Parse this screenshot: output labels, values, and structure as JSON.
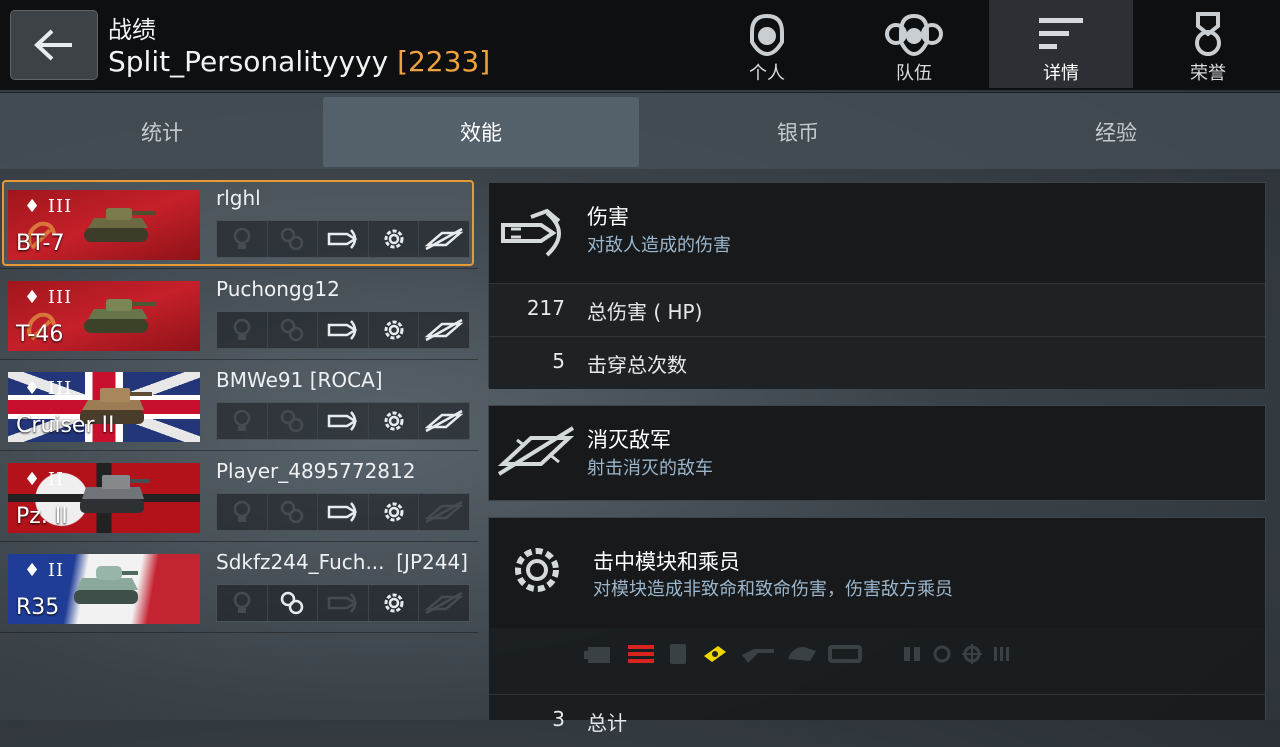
{
  "header": {
    "title": "战绩",
    "player_name": "Split_Personalityyyy",
    "rating": "[2233]",
    "tabs": [
      {
        "label": "个人",
        "icon": "soldier-icon",
        "active": false
      },
      {
        "label": "队伍",
        "icon": "team-icon",
        "active": false
      },
      {
        "label": "详情",
        "icon": "details-list-icon",
        "active": true
      },
      {
        "label": "荣誉",
        "icon": "medal-icon",
        "active": false
      }
    ]
  },
  "subtabs": [
    {
      "label": "统计",
      "active": false
    },
    {
      "label": "效能",
      "active": true
    },
    {
      "label": "银币",
      "active": false
    },
    {
      "label": "经验",
      "active": false
    }
  ],
  "players": [
    {
      "name": "rlghl",
      "clan": "",
      "tank": "BT-7",
      "tier": "III",
      "nation": "ussr",
      "selected": true,
      "medals": [
        false,
        false,
        true,
        true,
        true
      ]
    },
    {
      "name": "Puchongg12",
      "clan": "",
      "tank": "T-46",
      "tier": "III",
      "nation": "ussr",
      "selected": false,
      "medals": [
        false,
        false,
        true,
        true,
        true
      ]
    },
    {
      "name": "BMWe91 [ROCA]",
      "clan": "",
      "tank": "Cruiser II",
      "tier": "III",
      "nation": "uk",
      "selected": false,
      "medals": [
        false,
        false,
        true,
        true,
        true
      ]
    },
    {
      "name": "Player_4895772812",
      "clan": "",
      "tank": "Pz. II",
      "tier": "II",
      "nation": "germany",
      "selected": false,
      "medals": [
        false,
        false,
        true,
        true,
        false
      ]
    },
    {
      "name": "Sdkfz244_Fuch...",
      "clan": "[JP244]",
      "tank": "R35",
      "tier": "II",
      "nation": "france",
      "selected": false,
      "medals": [
        false,
        true,
        false,
        true,
        false
      ]
    }
  ],
  "damage": {
    "title": "伤害",
    "subtitle": "对敌人造成的伤害",
    "rows": [
      {
        "value": "217",
        "label": "总伤害 ( HP)"
      },
      {
        "value": "5",
        "label": "击穿总次数"
      }
    ]
  },
  "kills": {
    "title": "消灭敌军",
    "subtitle": "射击消灭的敌车"
  },
  "modules": {
    "title": "击中模块和乘员",
    "subtitle": "对模块造成非致命和致命伤害，伤害敌方乘员",
    "total_value": "3",
    "total_label": "总计"
  },
  "colors": {
    "accent": "#f0a33c",
    "selected_border": "#e59a35",
    "hit_red": "#d8231f",
    "hit_yellow": "#f2d600"
  }
}
